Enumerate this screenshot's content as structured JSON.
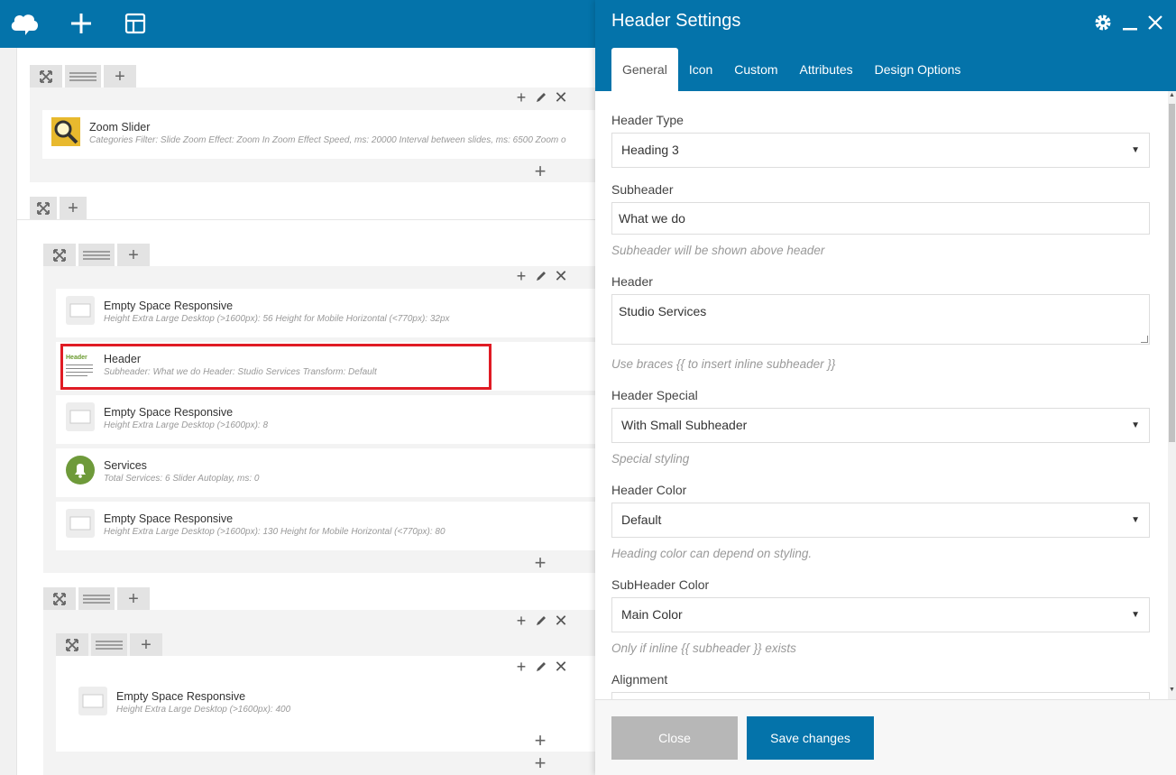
{
  "colors": {
    "brand": "#0473aa",
    "highlight": "#e01b24"
  },
  "toolbar": {
    "icons": [
      "cloud-logo-icon",
      "add-icon",
      "layout-icon"
    ]
  },
  "canvas": {
    "zoom_slider": {
      "title": "Zoom Slider",
      "desc": "Categories Filter: Slide  Zoom Effect: Zoom In  Zoom Effect Speed, ms: 20000  Interval between slides, ms: 6500  Zoom o"
    },
    "elements": [
      {
        "title": "Empty Space Responsive",
        "desc": "Height Extra Large Desktop (>1600px): 56  Height for Mobile Horizontal (<770px): 32px"
      },
      {
        "title": "Header",
        "desc": "Subheader: What we do  Header: Studio Services  Transform: Default",
        "icon_text": "Header"
      },
      {
        "title": "Empty Space Responsive",
        "desc": "Height Extra Large Desktop (>1600px): 8"
      },
      {
        "title": "Services",
        "desc": "Total Services: 6  Slider Autoplay, ms: 0"
      },
      {
        "title": "Empty Space Responsive",
        "desc": "Height Extra Large Desktop (>1600px): 130  Height for Mobile Horizontal (<770px): 80"
      }
    ],
    "last_element": {
      "title": "Empty Space Responsive",
      "desc": "Height Extra Large Desktop (>1600px): 400"
    }
  },
  "panel": {
    "title": "Header Settings",
    "tabs": [
      "General",
      "Icon",
      "Custom",
      "Attributes",
      "Design Options"
    ],
    "active_tab": "General",
    "fields": {
      "header_type": {
        "label": "Header Type",
        "value": "Heading 3"
      },
      "subheader": {
        "label": "Subheader",
        "value": "What we do",
        "help": "Subheader will be shown above header"
      },
      "header": {
        "label": "Header",
        "value": "Studio Services",
        "help": "Use braces {{ to insert inline subheader }}"
      },
      "header_special": {
        "label": "Header Special",
        "value": "With Small Subheader",
        "help": "Special styling"
      },
      "header_color": {
        "label": "Header Color",
        "value": "Default",
        "help": "Heading color can depend on styling."
      },
      "subheader_color": {
        "label": "SubHeader Color",
        "value": "Main Color",
        "help": "Only if inline {{ subheader }} exists"
      },
      "alignment": {
        "label": "Alignment"
      }
    },
    "buttons": {
      "close": "Close",
      "save": "Save changes"
    }
  }
}
